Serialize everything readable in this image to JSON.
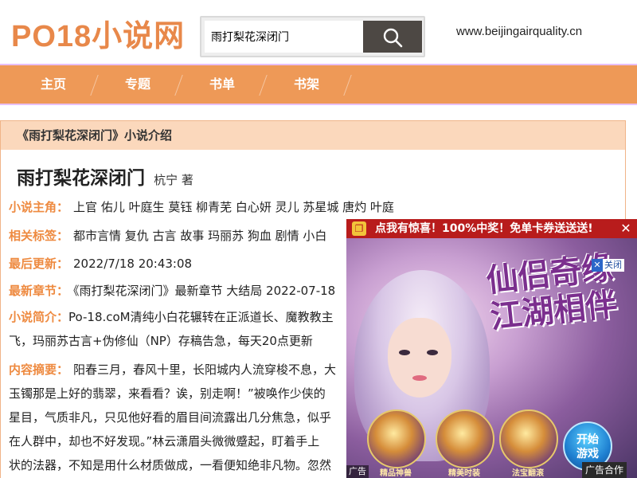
{
  "header": {
    "logo": "PO18小说网",
    "search_value": "雨打梨花深闭门",
    "site_url": "www.beijingairquality.cn"
  },
  "nav": {
    "items": [
      {
        "label": "主页"
      },
      {
        "label": "专题"
      },
      {
        "label": "书单"
      },
      {
        "label": "书架"
      }
    ]
  },
  "book": {
    "section_title": "《雨打梨花深闭门》小说介绍",
    "title": "雨打梨花深闭门",
    "author": "杭宁 著",
    "protagonists_label": "小说主角：",
    "protagonists": "上官 佑儿 叶庭生 莫钰 柳青芜 白心妍 灵儿 苏星城 唐灼 叶庭",
    "tags_label": "相关标签：",
    "tags": "都市言情 复仇 古言 故事 玛丽苏 狗血 剧情 小白 ",
    "updated_label": "最后更新：",
    "updated": "2022/7/18 20:43:08",
    "latest_label": "最新章节：",
    "latest": "《雨打梨花深闭门》最新章节 大结局 2022-07-18",
    "intro_label": "小说简介：",
    "intro_line1": "Po-18.coM清纯小白花辗转在正派道长、魔教教主",
    "intro_line2": "飞，玛丽苏古言+伪修仙（NP）存稿告急，每天20点更新",
    "summary_label": "内容摘要：",
    "summary_line1": "阳春三月，春风十里，长阳城内人流穿梭不息，大",
    "summary_line2": "玉镯那是上好的翡翠，来看看？诶，别走啊！”被唤作少侠的",
    "summary_line3": "星目，气质非凡，只见他好看的眉目间流露出几分焦急，似乎",
    "summary_line4": "在人群中，却也不好发现。”林云潇眉头微微蹙起，盯着手上",
    "summary_line5": "状的法器，不知是用什么材质做成，一看便知绝非凡物。忽然"
  },
  "ad": {
    "top_text": "点我有惊喜！100%中奖！免单卡券送送送!",
    "top_close": "✕",
    "close_label": "关闭",
    "close_x": "✕",
    "slogan_line1": "仙侣奇缘",
    "slogan_line2": "江湖相伴",
    "orb_labels": [
      "精品神兽",
      "精美时装",
      "法宝翻滚"
    ],
    "start_line1": "开始",
    "start_line2": "游戏",
    "badge": "广告",
    "coop": "广告合作"
  }
}
